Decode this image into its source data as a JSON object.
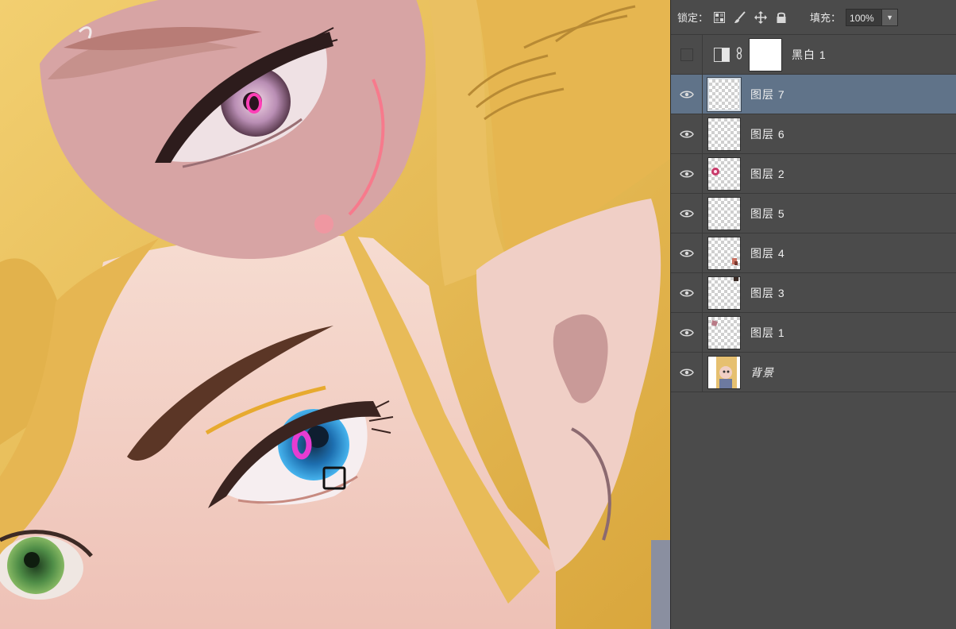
{
  "toolbar": {
    "lock_label": "锁定：",
    "lock_icons": [
      "lock-transparent-icon",
      "lock-paint-icon",
      "lock-move-icon",
      "lock-all-icon"
    ],
    "fill_label": "填充：",
    "fill_value": "100%"
  },
  "layers": [
    {
      "name": "黑白 1",
      "type": "adjustment",
      "visible": false,
      "selected": false
    },
    {
      "name": "图层 7",
      "type": "pixel",
      "visible": true,
      "selected": true
    },
    {
      "name": "图层 6",
      "type": "pixel",
      "visible": true,
      "selected": false
    },
    {
      "name": "图层 2",
      "type": "pixel",
      "visible": true,
      "selected": false
    },
    {
      "name": "图层 5",
      "type": "pixel",
      "visible": true,
      "selected": false
    },
    {
      "name": "图层 4",
      "type": "pixel",
      "visible": true,
      "selected": false
    },
    {
      "name": "图层 3",
      "type": "pixel",
      "visible": true,
      "selected": false
    },
    {
      "name": "图层 1",
      "type": "pixel",
      "visible": true,
      "selected": false
    },
    {
      "name": "背景",
      "type": "background",
      "visible": true,
      "selected": false
    }
  ],
  "colors": {
    "panel_bg": "#4b4b4b",
    "selected_row": "#607389",
    "hair": "#e9b95a",
    "skin": "#f1cfc5",
    "iris_blue": "#2f8fd0",
    "marker_magenta": "#e63cd2"
  }
}
